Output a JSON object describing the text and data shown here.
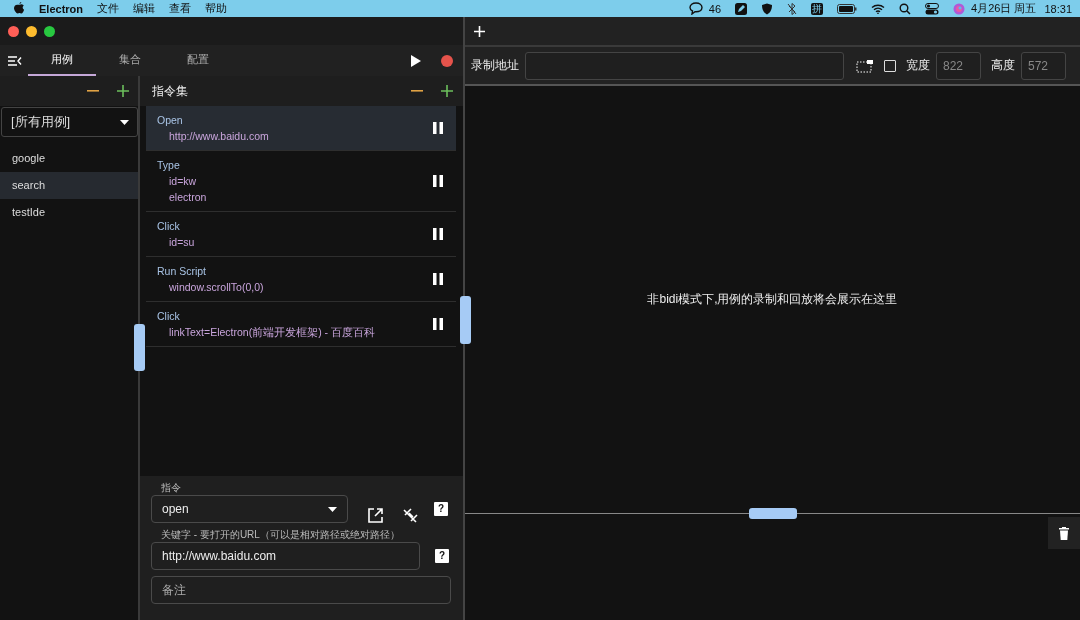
{
  "menubar": {
    "app": "Electron",
    "menus": [
      "文件",
      "编辑",
      "查看",
      "帮助"
    ],
    "chat_count": "46",
    "input_method": "拼",
    "date": "4月26日 周五",
    "time": "18:31"
  },
  "tabs": [
    {
      "label": "用例",
      "selected": true
    },
    {
      "label": "集合",
      "selected": false
    },
    {
      "label": "配置",
      "selected": false
    }
  ],
  "cases": {
    "filter": "[所有用例]",
    "items": [
      {
        "name": "google",
        "selected": false
      },
      {
        "name": "search",
        "selected": true
      },
      {
        "name": "testIde",
        "selected": false
      }
    ]
  },
  "commands": {
    "title": "指令集",
    "items": [
      {
        "name": "Open",
        "args": [
          "http://www.baidu.com"
        ],
        "selected": true
      },
      {
        "name": "Type",
        "args": [
          "id=kw",
          "electron"
        ],
        "selected": false
      },
      {
        "name": "Click",
        "args": [
          "id=su"
        ],
        "selected": false
      },
      {
        "name": "Run Script",
        "args": [
          "window.scrollTo(0,0)"
        ],
        "selected": false
      },
      {
        "name": "Click",
        "args": [
          "linkText=Electron(前端开发框架) - 百度百科"
        ],
        "selected": false
      }
    ]
  },
  "form": {
    "command": {
      "label": "指令",
      "value": "open",
      "help": "?"
    },
    "keyword": {
      "label": "关键字 - 要打开的URL（可以是相对路径或绝对路径）",
      "value": "http://www.baidu.com",
      "help": "?"
    },
    "note": {
      "placeholder": "备注"
    }
  },
  "recorder": {
    "url_label": "录制地址",
    "checked": false,
    "width_label": "宽度",
    "width_placeholder": "822",
    "height_label": "高度",
    "height_placeholder": "572",
    "message": "非bidi模式下,用例的录制和回放将会展示在这里"
  }
}
